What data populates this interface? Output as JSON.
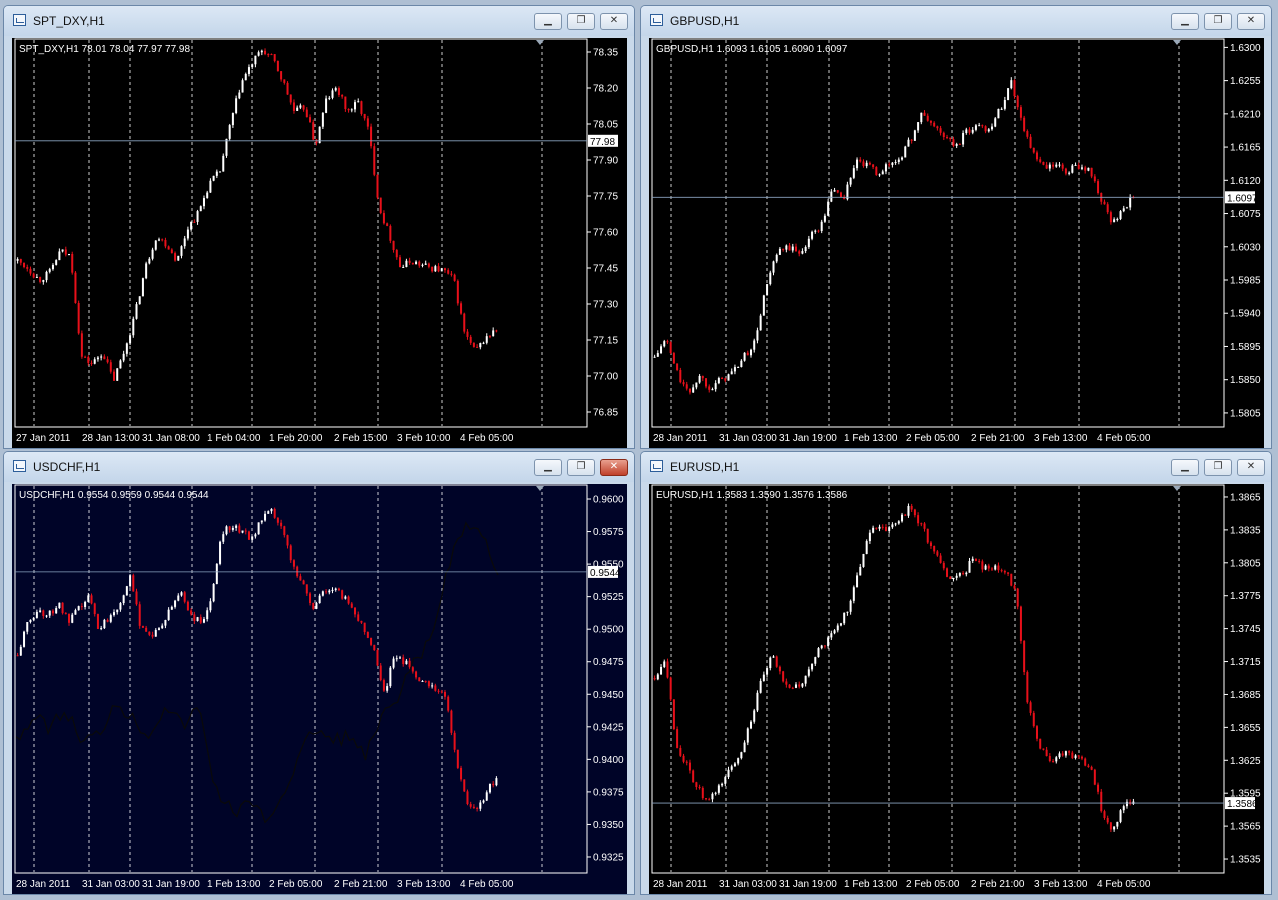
{
  "windows": [
    {
      "id": "dxy",
      "title": "SPT_DXY,H1",
      "info": "SPT_DXY,H1  78.01 78.04 77.97 77.98",
      "bg": "#000000",
      "active": false,
      "price_axis": [
        "78.35",
        "78.20",
        "78.05",
        "77.90",
        "77.75",
        "77.60",
        "77.45",
        "77.30",
        "77.15",
        "77.00",
        "76.85"
      ],
      "time_axis": [
        "27 Jan 2011",
        "28 Jan 13:00",
        "31 Jan 08:00",
        "1 Feb 04:00",
        "1 Feb 20:00",
        "2 Feb 15:00",
        "3 Feb 10:00",
        "4 Feb 05:00"
      ],
      "current_price_label": "77.98",
      "chart_data": {
        "type": "candlestick",
        "ylim": [
          76.8,
          78.4
        ],
        "current": 77.98,
        "path": [
          77.48,
          77.45,
          77.4,
          77.43,
          77.52,
          77.5,
          77.08,
          77.05,
          77.1,
          76.98,
          77.1,
          77.25,
          77.45,
          77.58,
          77.55,
          77.48,
          77.62,
          77.68,
          77.8,
          77.85,
          78.05,
          78.22,
          78.3,
          78.36,
          78.32,
          78.22,
          78.1,
          78.12,
          77.96,
          78.15,
          78.2,
          78.1,
          78.14,
          78.02,
          77.7,
          77.58,
          77.45,
          77.48,
          77.46,
          77.45,
          77.44,
          77.4,
          77.18,
          77.1,
          77.16,
          77.19
        ]
      }
    },
    {
      "id": "gbpusd",
      "title": "GBPUSD,H1",
      "info": "GBPUSD,H1  1.6093 1.6105 1.6090 1.6097",
      "bg": "#000000",
      "active": false,
      "price_axis": [
        "1.6300",
        "1.6255",
        "1.6210",
        "1.6165",
        "1.6120",
        "1.6075",
        "1.6030",
        "1.5985",
        "1.5940",
        "1.5895",
        "1.5850",
        "1.5805"
      ],
      "time_axis": [
        "28 Jan 2011",
        "31 Jan 03:00",
        "31 Jan 19:00",
        "1 Feb 13:00",
        "2 Feb 05:00",
        "2 Feb 21:00",
        "3 Feb 13:00",
        "4 Feb 05:00"
      ],
      "current_price_label": "1.6097",
      "chart_data": {
        "type": "candlestick",
        "ylim": [
          1.579,
          1.631
        ],
        "current": 1.6097,
        "path": [
          1.588,
          1.5905,
          1.586,
          1.583,
          1.5855,
          1.584,
          1.585,
          1.586,
          1.588,
          1.59,
          1.5975,
          1.602,
          1.603,
          1.602,
          1.6045,
          1.606,
          1.611,
          1.6095,
          1.6145,
          1.614,
          1.613,
          1.614,
          1.615,
          1.6175,
          1.621,
          1.6195,
          1.618,
          1.6165,
          1.6185,
          1.6195,
          1.619,
          1.6215,
          1.6255,
          1.62,
          1.6155,
          1.6135,
          1.614,
          1.613,
          1.614,
          1.6135,
          1.61,
          1.606,
          1.608,
          1.6097
        ]
      }
    },
    {
      "id": "usdchf",
      "title": "USDCHF,H1",
      "info": "USDCHF,H1  0.9554 0.9559 0.9544 0.9544",
      "bg": "#000428",
      "active": true,
      "price_axis": [
        "0.9600",
        "0.9575",
        "0.9550",
        "0.9525",
        "0.9500",
        "0.9475",
        "0.9450",
        "0.9425",
        "0.9400",
        "0.9375",
        "0.9350",
        "0.9325"
      ],
      "time_axis": [
        "28 Jan 2011",
        "31 Jan 03:00",
        "31 Jan 19:00",
        "1 Feb 13:00",
        "2 Feb 05:00",
        "2 Feb 21:00",
        "3 Feb 13:00",
        "4 Feb 05:00"
      ],
      "current_price_label": "0.9544",
      "chart_data": {
        "type": "candlestick",
        "ylim": [
          0.9315,
          0.961
        ],
        "current": 0.9544,
        "path": [
          0.948,
          0.9505,
          0.9515,
          0.951,
          0.952,
          0.9505,
          0.9515,
          0.9525,
          0.95,
          0.951,
          0.952,
          0.954,
          0.9505,
          0.9495,
          0.95,
          0.9515,
          0.953,
          0.951,
          0.9505,
          0.952,
          0.9575,
          0.958,
          0.9575,
          0.957,
          0.9585,
          0.959,
          0.9575,
          0.955,
          0.9535,
          0.9515,
          0.953,
          0.953,
          0.9525,
          0.9515,
          0.95,
          0.9485,
          0.945,
          0.948,
          0.9475,
          0.9465,
          0.946,
          0.9455,
          0.945,
          0.94,
          0.937,
          0.936,
          0.9375,
          0.9385
        ]
      }
    },
    {
      "id": "eurusd",
      "title": "EURUSD,H1",
      "info": "EURUSD,H1  1.3583 1.3590 1.3576 1.3586",
      "bg": "#000000",
      "active": false,
      "price_axis": [
        "1.3865",
        "1.3835",
        "1.3805",
        "1.3775",
        "1.3745",
        "1.3715",
        "1.3685",
        "1.3655",
        "1.3625",
        "1.3595",
        "1.3565",
        "1.3535"
      ],
      "time_axis": [
        "28 Jan 2011",
        "31 Jan 03:00",
        "31 Jan 19:00",
        "1 Feb 13:00",
        "2 Feb 05:00",
        "2 Feb 21:00",
        "3 Feb 13:00",
        "4 Feb 05:00"
      ],
      "current_price_label": "1.3586",
      "chart_data": {
        "type": "candlestick",
        "ylim": [
          1.3525,
          1.3875
        ],
        "current": 1.3586,
        "path": [
          1.37,
          1.372,
          1.364,
          1.362,
          1.36,
          1.3585,
          1.36,
          1.3615,
          1.363,
          1.366,
          1.3695,
          1.372,
          1.37,
          1.369,
          1.3695,
          1.372,
          1.373,
          1.3745,
          1.376,
          1.379,
          1.383,
          1.384,
          1.3835,
          1.3845,
          1.3855,
          1.384,
          1.382,
          1.38,
          1.379,
          1.3795,
          1.381,
          1.38,
          1.38,
          1.3795,
          1.378,
          1.368,
          1.364,
          1.3625,
          1.363,
          1.363,
          1.3625,
          1.362,
          1.358,
          1.356,
          1.3585,
          1.3586
        ]
      }
    }
  ],
  "colors": {
    "bull": "#ffffff",
    "bear": "#e8101a",
    "grid": "#ffffff",
    "axis_text": "#ffffff",
    "current_line": "#8aa3c0"
  },
  "icons": {
    "window": "chart-window-icon",
    "minimize": "minimize-icon",
    "restore": "restore-icon",
    "close": "close-icon"
  }
}
